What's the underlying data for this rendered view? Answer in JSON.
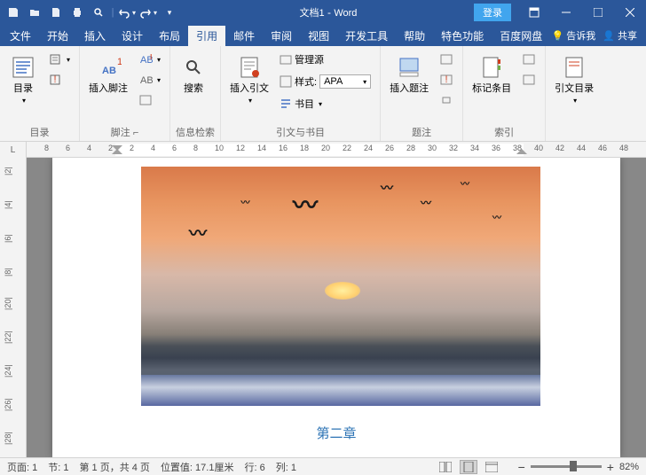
{
  "title": {
    "doc": "文档1",
    "app": "Word"
  },
  "login": "登录",
  "tabs": [
    "文件",
    "开始",
    "插入",
    "设计",
    "布局",
    "引用",
    "邮件",
    "审阅",
    "视图",
    "开发工具",
    "帮助",
    "特色功能",
    "百度网盘"
  ],
  "active_tab": 5,
  "tellme": "告诉我",
  "share": "共享",
  "ribbon": {
    "g1": {
      "label": "目录",
      "btn": "目录"
    },
    "g2": {
      "label": "脚注",
      "btn": "插入脚注",
      "small": "AB¹"
    },
    "g3": {
      "label": "信息检索",
      "btn": "搜索"
    },
    "g4": {
      "label": "引文与书目",
      "btn": "插入引文",
      "r1": "管理源",
      "r2": "样式:",
      "r2v": "APA",
      "r3": "书目"
    },
    "g5": {
      "label": "题注",
      "btn": "插入题注"
    },
    "g6": {
      "label": "索引",
      "btn": "标记条目"
    },
    "g7": {
      "label": "",
      "btn": "引文目录"
    }
  },
  "hruler_nums": [
    "8",
    "6",
    "4",
    "2",
    "2",
    "4",
    "6",
    "8",
    "10",
    "12",
    "14",
    "16",
    "18",
    "20",
    "22",
    "24",
    "26",
    "28",
    "30",
    "32",
    "34",
    "36",
    "38",
    "40",
    "42",
    "44",
    "46",
    "48"
  ],
  "vruler_nums": [
    "|2|",
    "|4|",
    "|6|",
    "|8|",
    "|20|",
    "|22|",
    "|24|",
    "|26|",
    "|28|"
  ],
  "chapter": "第二章",
  "status": {
    "page": "页面: 1",
    "sec": "节: 1",
    "pages": "第 1 页，共 4 页",
    "pos": "位置值: 17.1厘米",
    "line": "行: 6",
    "col": "列: 1",
    "zoom": "82%"
  }
}
